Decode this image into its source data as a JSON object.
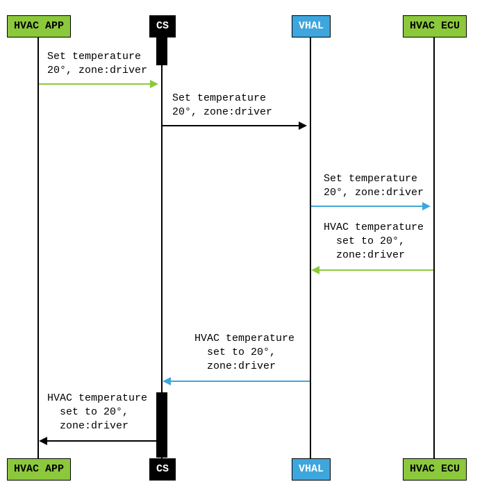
{
  "actors": {
    "hvac_app": "HVAC APP",
    "cs": "CS",
    "vhal": "VHAL",
    "hvac_ecu": "HVAC ECU"
  },
  "messages": {
    "m1": "Set temperature\n20°, zone:driver",
    "m2": "Set temperature\n20°, zone:driver",
    "m3": "Set temperature\n20°, zone:driver",
    "m4": "HVAC temperature\n  set to 20°,\n  zone:driver",
    "m5": "HVAC temperature\n  set to 20°,\n  zone:driver",
    "m6": "HVAC temperature\n  set to 20°,\n  zone:driver"
  },
  "chart_data": {
    "type": "sequence-diagram",
    "actors": [
      "HVAC APP",
      "CS",
      "VHAL",
      "HVAC ECU"
    ],
    "messages": [
      {
        "from": "HVAC APP",
        "to": "CS",
        "text": "Set temperature 20°, zone:driver",
        "color": "green"
      },
      {
        "from": "CS",
        "to": "VHAL",
        "text": "Set temperature 20°, zone:driver",
        "color": "black"
      },
      {
        "from": "VHAL",
        "to": "HVAC ECU",
        "text": "Set temperature 20°, zone:driver",
        "color": "blue"
      },
      {
        "from": "HVAC ECU",
        "to": "VHAL",
        "text": "HVAC temperature set to 20°, zone:driver",
        "color": "green"
      },
      {
        "from": "VHAL",
        "to": "CS",
        "text": "HVAC temperature set to 20°, zone:driver",
        "color": "blue"
      },
      {
        "from": "CS",
        "to": "HVAC APP",
        "text": "HVAC temperature set to 20°, zone:driver",
        "color": "black"
      }
    ]
  }
}
